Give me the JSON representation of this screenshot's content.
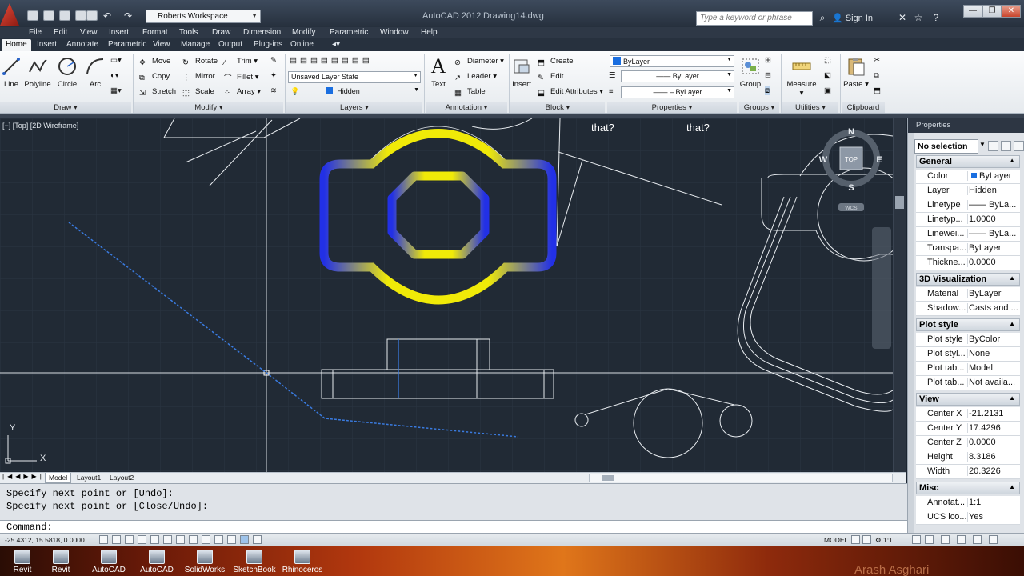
{
  "titlebar": {
    "workspace": "Roberts Workspace",
    "app_title": "AutoCAD 2012",
    "doc_title": "Drawing14.dwg",
    "search_placeholder": "Type a keyword or phrase",
    "sign_in": "Sign In"
  },
  "menubar": [
    "File",
    "Edit",
    "View",
    "Insert",
    "Format",
    "Tools",
    "Draw",
    "Dimension",
    "Modify",
    "Parametric",
    "Window",
    "Help"
  ],
  "ribbon_tabs": [
    "Home",
    "Insert",
    "Annotate",
    "Parametric",
    "View",
    "Manage",
    "Output",
    "Plug-ins",
    "Online"
  ],
  "ribbon": {
    "draw": {
      "title": "Draw",
      "tools": [
        "Line",
        "Polyline",
        "Circle",
        "Arc"
      ]
    },
    "modify": {
      "title": "Modify",
      "tools": [
        "Move",
        "Rotate",
        "Trim",
        "Copy",
        "Mirror",
        "Fillet",
        "Stretch",
        "Scale",
        "Array"
      ]
    },
    "layers": {
      "title": "Layers",
      "layer_state": "Unsaved Layer State",
      "current_layer": "Hidden"
    },
    "annotation": {
      "title": "Annotation",
      "text": "Text",
      "diameter": "Diameter",
      "leader": "Leader",
      "table": "Table"
    },
    "block": {
      "title": "Block",
      "insert": "Insert",
      "create": "Create",
      "edit": "Edit",
      "edit_attributes": "Edit Attributes"
    },
    "properties": {
      "title": "Properties",
      "color": "ByLayer",
      "linetype": "ByLayer",
      "lineweight": "ByLayer"
    },
    "groups": {
      "title": "Groups",
      "group": "Group"
    },
    "utilities": {
      "title": "Utilities",
      "measure": "Measure"
    },
    "clipboard": {
      "title": "Clipboard",
      "paste": "Paste"
    }
  },
  "viewport": {
    "label": "[−] [Top] [2D Wireframe]",
    "annotations": [
      "that?",
      "that?"
    ],
    "viewcube": {
      "n": "N",
      "s": "S",
      "e": "E",
      "w": "W",
      "top": "TOP",
      "wcs": "WCS"
    },
    "ucs": {
      "y": "Y",
      "x": "X"
    }
  },
  "layout_tabs": [
    "Model",
    "Layout1",
    "Layout2"
  ],
  "command": {
    "history": [
      "Specify next point or [Undo]:",
      "Specify next point or [Close/Undo]:"
    ],
    "prompt": "Command:"
  },
  "statusbar": {
    "coords": "-25.4312, 15.5818, 0.0000",
    "model": "MODEL",
    "scale": "1:1"
  },
  "properties": {
    "title": "Properties",
    "selection": "No selection",
    "sections": [
      {
        "name": "General",
        "rows": [
          {
            "key": "Color",
            "value": "ByLayer"
          },
          {
            "key": "Layer",
            "value": "Hidden"
          },
          {
            "key": "Linetype",
            "value": "—— ByLa..."
          },
          {
            "key": "Linetyp...",
            "value": "1.0000"
          },
          {
            "key": "Linewei...",
            "value": "—— ByLa..."
          },
          {
            "key": "Transpa...",
            "value": "ByLayer"
          },
          {
            "key": "Thickne...",
            "value": "0.0000"
          }
        ]
      },
      {
        "name": "3D Visualization",
        "rows": [
          {
            "key": "Material",
            "value": "ByLayer"
          },
          {
            "key": "Shadow...",
            "value": "Casts and ..."
          }
        ]
      },
      {
        "name": "Plot style",
        "rows": [
          {
            "key": "Plot style",
            "value": "ByColor"
          },
          {
            "key": "Plot styl...",
            "value": "None"
          },
          {
            "key": "Plot tab...",
            "value": "Model"
          },
          {
            "key": "Plot tab...",
            "value": "Not availa..."
          }
        ]
      },
      {
        "name": "View",
        "rows": [
          {
            "key": "Center X",
            "value": "-21.2131"
          },
          {
            "key": "Center Y",
            "value": "17.4296"
          },
          {
            "key": "Center Z",
            "value": "0.0000"
          },
          {
            "key": "Height",
            "value": "8.3186"
          },
          {
            "key": "Width",
            "value": "20.3226"
          }
        ]
      },
      {
        "name": "Misc",
        "rows": [
          {
            "key": "Annotat...",
            "value": "1:1"
          },
          {
            "key": "UCS ico...",
            "value": "Yes"
          }
        ]
      }
    ]
  },
  "taskbar": {
    "items": [
      "Revit",
      "Revit",
      "AutoCAD",
      "AutoCAD",
      "SolidWorks",
      "SketchBook",
      "Rhinoceros"
    ],
    "watermark": "Arash Asghari"
  },
  "colors": {
    "viewport_bg": "#212a35",
    "drawing_yellow": "#f2ea0a",
    "drawing_blue": "#1f2ee0",
    "selection_blue": "#3a7be0"
  }
}
